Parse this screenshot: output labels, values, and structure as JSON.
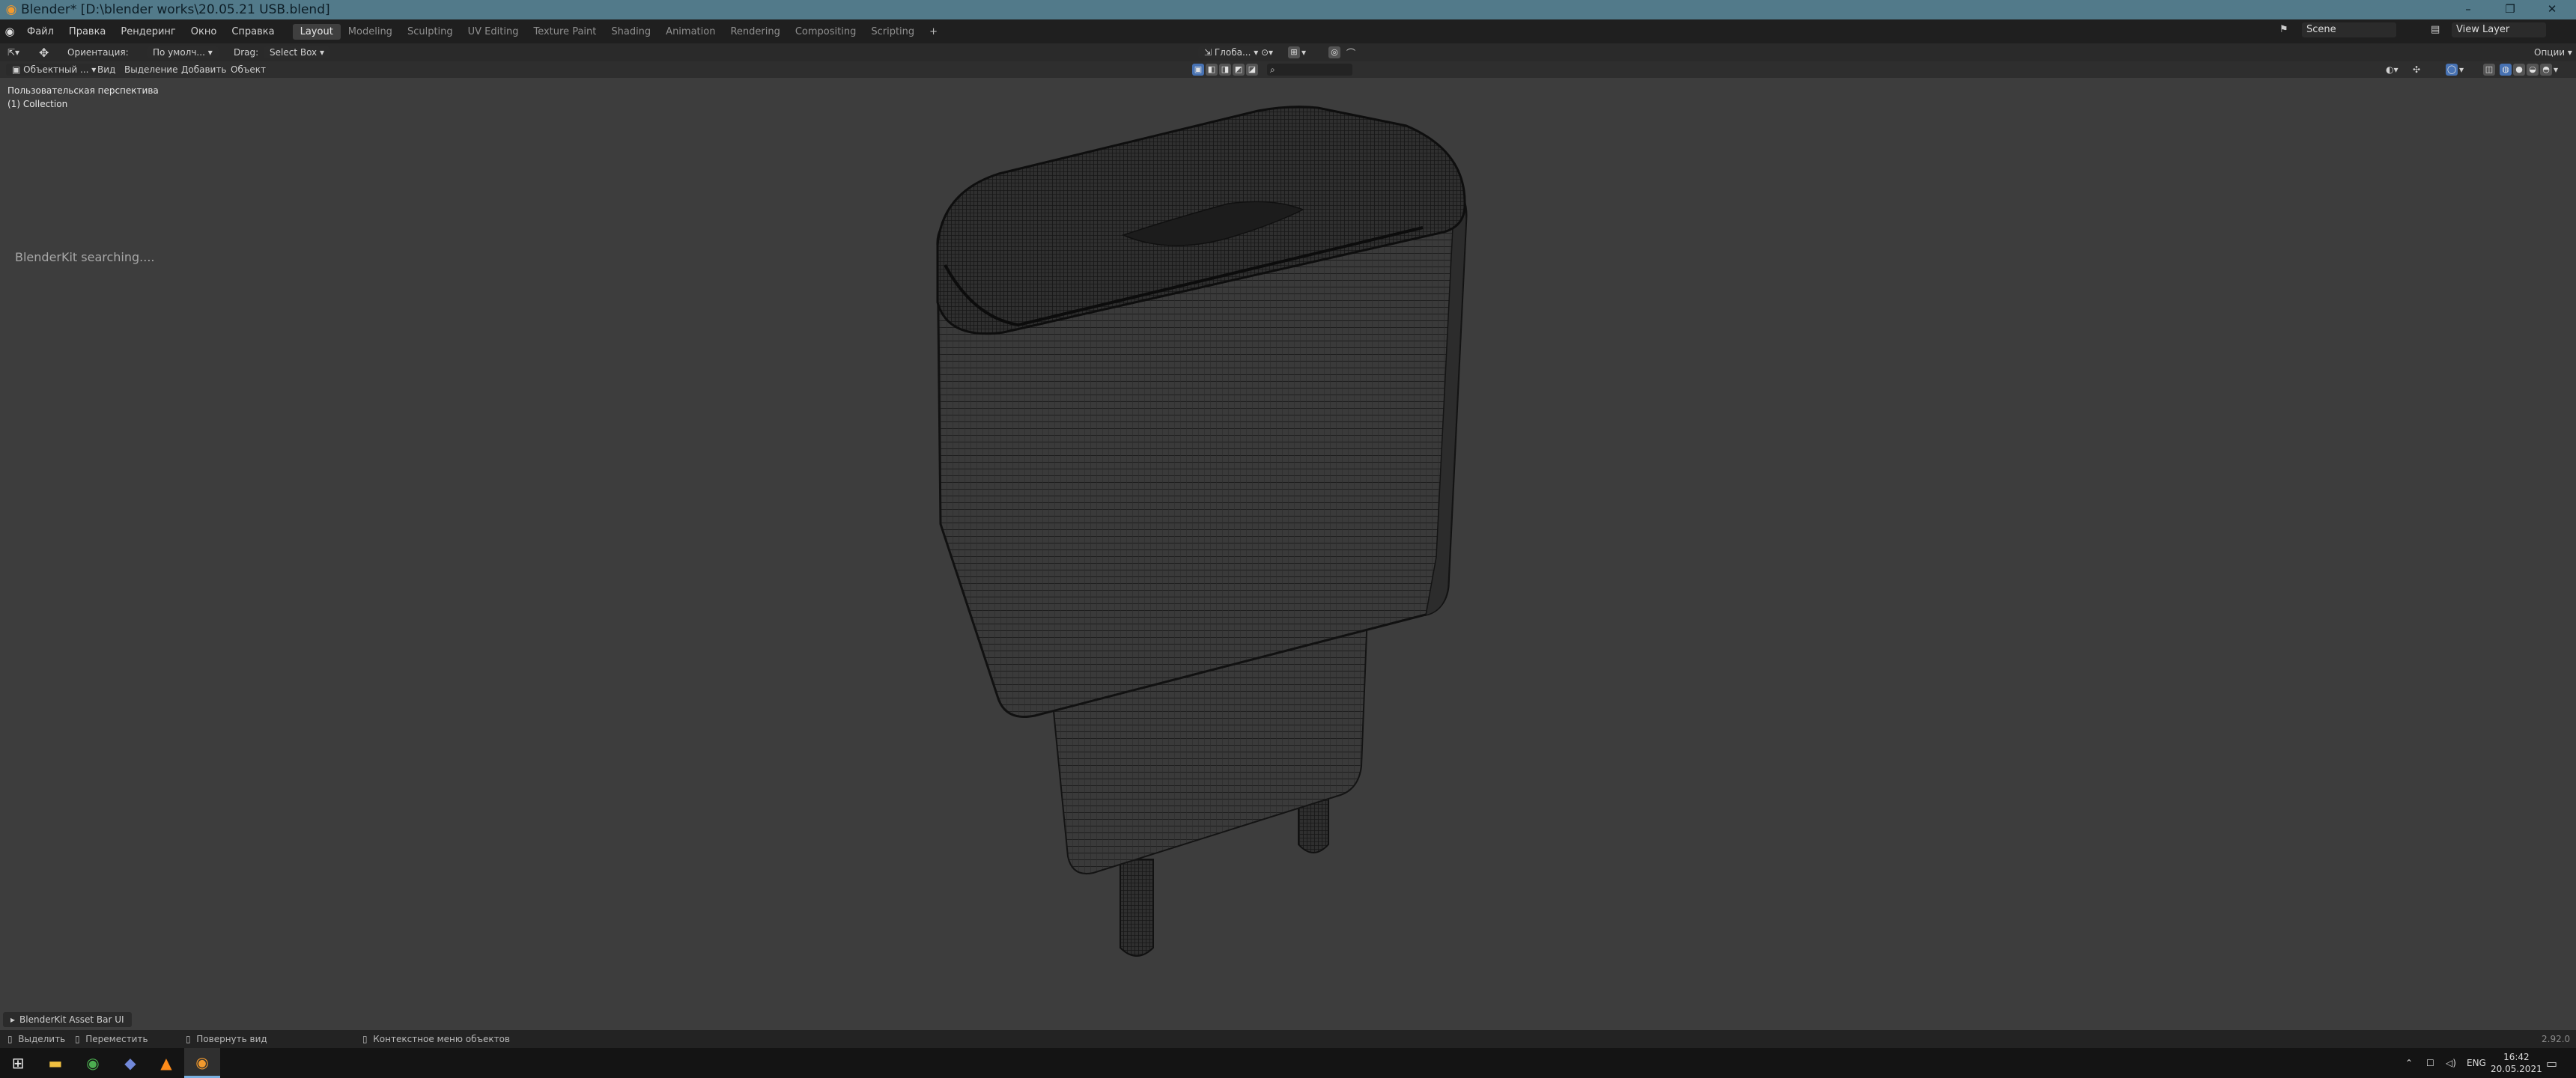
{
  "window": {
    "title": "Blender* [D:\\blender works\\20.05.21 USB.blend]",
    "controls": [
      "–",
      "❐",
      "✕"
    ]
  },
  "menu": [
    "Файл",
    "Правка",
    "Рендеринг",
    "Окно",
    "Справка"
  ],
  "workspaces": [
    "Layout",
    "Modeling",
    "Sculpting",
    "UV Editing",
    "Texture Paint",
    "Shading",
    "Animation",
    "Rendering",
    "Compositing",
    "Scripting"
  ],
  "add_workspace": "+",
  "scene": {
    "name": "Scene",
    "view_layer": "View Layer"
  },
  "tool_header": {
    "orientation_label": "Ориентация:",
    "orientation_value": "По умолч...",
    "drag_label": "Drag:",
    "drag_value": "Select Box",
    "transform_value": "Глоба...",
    "options_label": "Опции"
  },
  "viewport_header": {
    "mode": "Объектный ...",
    "menus": [
      "Вид",
      "Выделение",
      "Добавить",
      "Объект"
    ]
  },
  "viewport": {
    "perspective": "Пользовательская перспектива",
    "collection": "(1) Collection",
    "blenderkit_status": "BlenderKit searching....",
    "asset_bar": "BlenderKit Asset Bar UI"
  },
  "status_bar": {
    "items": [
      "Выделить",
      "Переместить",
      "Повернуть вид",
      "Контекстное меню объектов"
    ],
    "version": "2.92.0"
  },
  "taskbar": {
    "language": "ENG",
    "time": "16:42",
    "date": "20.05.2021"
  },
  "colors": {
    "title_bar": "#527a8a",
    "accent_blue": "#4772b3",
    "blender_orange": "#f29a2e",
    "viewport_bg": "#3d3d3d"
  }
}
